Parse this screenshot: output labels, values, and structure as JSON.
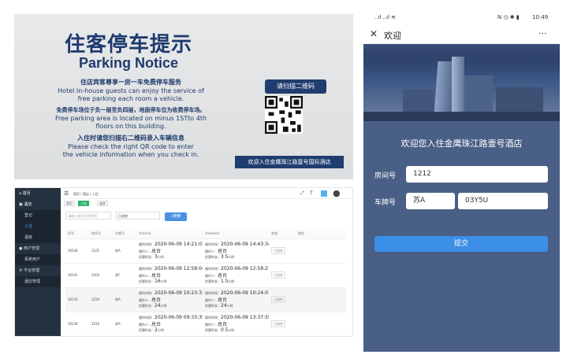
{
  "sign": {
    "title_cn": "住客停车提示",
    "title_en": "Parking Notice",
    "line1": "住店宾客尊享一房一车免费停车服务",
    "line2": "Hotel In-house guests can enjoy the service of",
    "line3": "free parking each room a vehicle.",
    "line4": "免费停车场位于负一层至负四层，地面停车位为收费停车场。",
    "line5": "Free parking area is located on minus 1STto 4th",
    "line6": "floors on this building.",
    "line7": "入住时请您扫描右二维码录入车辆信息",
    "line8": "Please check the right QR code to enter",
    "line9": "the vehicle information when you check in.",
    "qr_button": "请扫描二维码",
    "welcome": "欢迎入住金鹰珠江路壹号国际酒店"
  },
  "admin": {
    "sidebar": [
      {
        "label": "首页",
        "type": "top"
      },
      {
        "label": "酒店",
        "type": "top"
      },
      {
        "label": "登记",
        "type": "sub"
      },
      {
        "label": "入住",
        "type": "sub-active"
      },
      {
        "label": "退房",
        "type": "sub"
      },
      {
        "label": "用户管理",
        "type": "top"
      },
      {
        "label": "系统用户",
        "type": "sub"
      },
      {
        "label": "平台管理",
        "type": "top"
      },
      {
        "label": "酒店管理",
        "type": "sub"
      }
    ],
    "breadcrumb": "首页 / 酒店 / 入住",
    "tabs": [
      "首页",
      "入住",
      "退房"
    ],
    "filter_placeholder": "请输入房间号/车牌号",
    "filter_select": "已退房",
    "search_label": "搜索",
    "columns": [
      "序号",
      "房间号",
      "车牌号",
      "checkin",
      "checkout",
      "状态",
      "操作"
    ],
    "rows": [
      {
        "id": "16144",
        "room": "1101",
        "plate": "苏A",
        "checkin": "2020-06-09 14:21:02",
        "checkin_op": "总台",
        "checkin_dur": "3",
        "checkout": "2020-06-09 14:43:34",
        "checkout_op": "总台",
        "checkout_dur": "3.5",
        "status": "已退房"
      },
      {
        "id": "16141",
        "room": "2202",
        "plate": "苏F",
        "checkin": "2020-06-09 12:58:04",
        "checkin_op": "总台",
        "checkin_dur": "16",
        "checkout": "2020-06-09 12:58:27",
        "checkout_op": "总台",
        "checkout_dur": "1.5",
        "status": "已退房"
      },
      {
        "id": "16135",
        "room": "1220",
        "plate": "苏A",
        "checkin": "2020-06-09 10:23:33",
        "checkin_op": "总台",
        "checkin_dur": "24",
        "checkout": "2020-06-09 10:24:07",
        "checkout_op": "总台",
        "checkout_dur": "24",
        "status": "已退房"
      },
      {
        "id": "16134",
        "room": "1516",
        "plate": "苏A",
        "checkin": "2020-06-09 09:33:35",
        "checkin_op": "总台",
        "checkin_dur": "2",
        "checkout": "2020-06-09 13:37:55",
        "checkout_op": "总台",
        "checkout_dur": "0.5",
        "status": "已退房"
      }
    ],
    "labels": {
      "op_time": "操作时间：",
      "operator": "操作人：",
      "free_time": "优惠时长：",
      "unit": "小时"
    }
  },
  "phone": {
    "status_left": "..ıl ..ıl ≋",
    "time": "10:49",
    "status_right": "N ◷ ✱ ▮",
    "close_glyph": "✕",
    "title": "欢迎",
    "more_glyph": "···",
    "welcome": "欢迎您入住金鹰珠江路壹号酒店",
    "room_label": "房间号",
    "room_value": "1212",
    "plate_label": "车牌号",
    "plate_prefix": "苏A",
    "plate_value": "03Y5U",
    "submit": "提交"
  },
  "colors": {
    "sign_blue": "#1e3a6e",
    "phone_bg": "#4a5f86",
    "submit": "#3b8fe6",
    "sidebar": "#24313f"
  }
}
